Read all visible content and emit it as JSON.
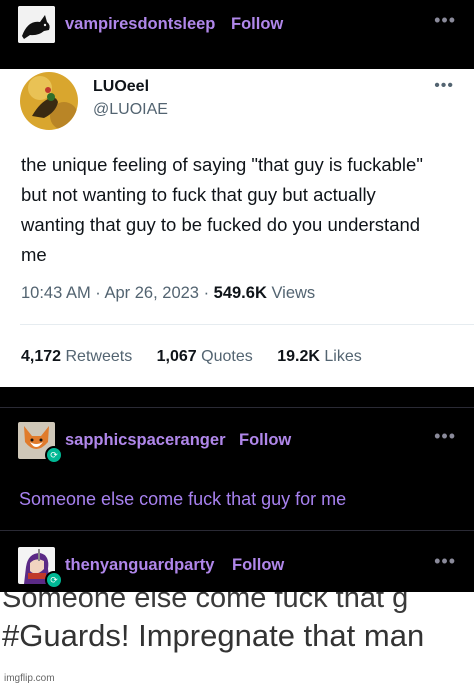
{
  "post": {
    "author": "vampiresdontsleep",
    "follow_label": "Follow",
    "menu_icon": "more-dots-icon"
  },
  "tweet": {
    "display_name": "LUOeel",
    "handle": "@LUOIAE",
    "text": "the unique feeling of saying \"that guy is fuckable\" but not wanting to fuck that guy but actually wanting that guy to be fucked do you understand me",
    "time": "10:43 AM",
    "date": "Apr 26, 2023",
    "views_count": "549.6K",
    "views_label": "Views",
    "retweets_count": "4,172",
    "retweets_label": "Retweets",
    "quotes_count": "1,067",
    "quotes_label": "Quotes",
    "likes_count": "19.2K",
    "likes_label": "Likes"
  },
  "reblogs": [
    {
      "author": "sapphicspaceranger",
      "follow_label": "Follow",
      "comment": "Someone else come fuck that guy for me"
    },
    {
      "author": "thenyanguardparty",
      "follow_label": "Follow"
    }
  ],
  "overlay": {
    "cutoff_text": "Someone else come fuck that g",
    "caption": "#Guards! Impregnate that man",
    "watermark": "imgflip.com"
  },
  "colors": {
    "username": "#b087ea",
    "comment": "#a781ef",
    "reblog_badge": "#00b894",
    "tweet_secondary": "#536471"
  }
}
